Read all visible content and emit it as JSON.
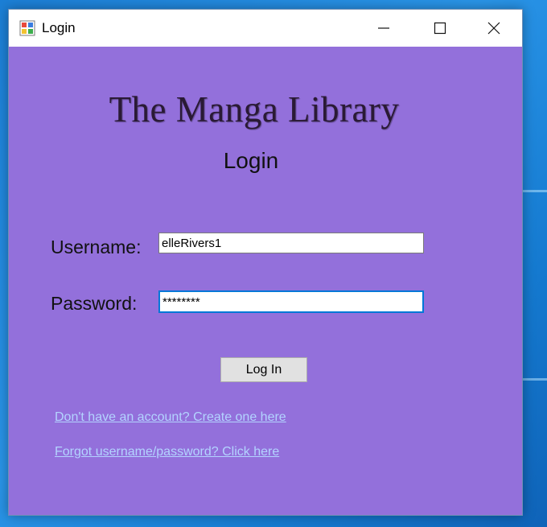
{
  "window": {
    "title": "Login",
    "controls": {
      "minimize_icon": "minimize-icon",
      "maximize_icon": "maximize-icon",
      "close_icon": "close-icon"
    }
  },
  "brand": {
    "title": "The Manga Library"
  },
  "form": {
    "heading": "Login",
    "username_label": "Username:",
    "username_value": "elleRivers1",
    "password_label": "Password:",
    "password_value": "********",
    "login_button": "Log In"
  },
  "links": {
    "create_account": "Don't have an account? Create one here",
    "forgot": "Forgot username/password? Click here"
  },
  "colors": {
    "form_background": "#9370db",
    "link_color": "#b3d4ff",
    "desktop": "#1c7fd6",
    "focus_border": "#0078d7"
  }
}
